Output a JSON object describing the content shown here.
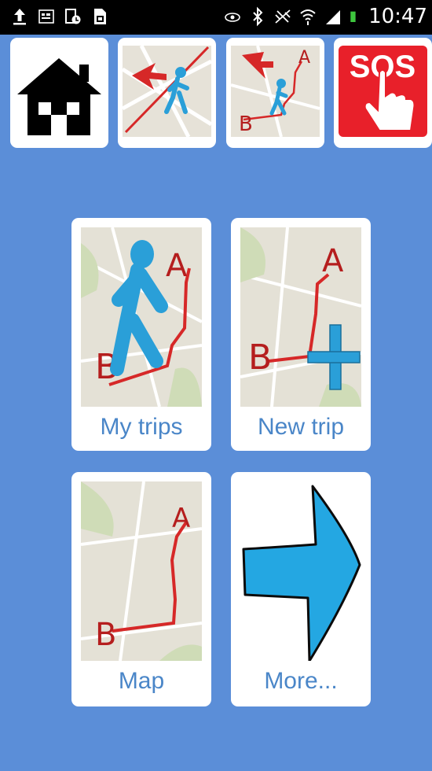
{
  "status_bar": {
    "time": "10:47",
    "left_icons": [
      "upload-icon",
      "notification-icon",
      "download-icon",
      "sim-icon"
    ],
    "right_icons": [
      "eye-icon",
      "bluetooth-icon",
      "no-signal-icon",
      "wifi-icon",
      "cell-signal-icon",
      "battery-icon"
    ]
  },
  "toolbar": [
    {
      "name": "home",
      "icon": "house-icon"
    },
    {
      "name": "location",
      "icon": "pedestrian-location-icon"
    },
    {
      "name": "route",
      "icon": "route-pedestrian-icon"
    },
    {
      "name": "sos",
      "icon": "sos-hand-icon",
      "text": "SOS"
    }
  ],
  "tiles": [
    {
      "label": "My trips",
      "icon": "walking-route-icon",
      "point_a": "A",
      "point_b": "B"
    },
    {
      "label": "New trip",
      "icon": "new-route-plus-icon",
      "point_a": "A",
      "point_b": "B"
    },
    {
      "label": "Map",
      "icon": "map-route-icon",
      "point_a": "A",
      "point_b": "B"
    },
    {
      "label": "More...",
      "icon": "arrow-right-icon"
    }
  ],
  "colors": {
    "background": "#5b8ed8",
    "label_text": "#4a86c8",
    "route_red": "#d62828",
    "walker_blue": "#2a9fd8",
    "sos_red": "#e8202a"
  }
}
